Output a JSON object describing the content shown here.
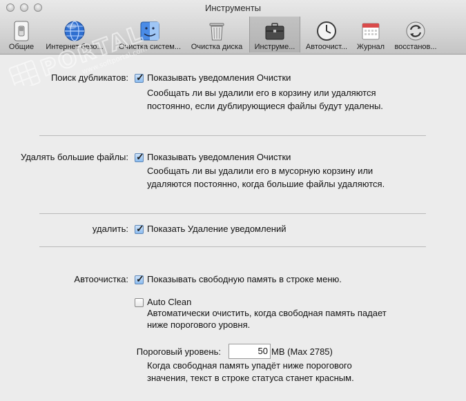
{
  "window": {
    "title": "Инструменты"
  },
  "toolbar": {
    "items": [
      {
        "label": "Общие",
        "icon": "switch-icon"
      },
      {
        "label": "Интернет безо...",
        "icon": "globe-icon"
      },
      {
        "label": "Очистка систем...",
        "icon": "finder-icon"
      },
      {
        "label": "Очистка диска",
        "icon": "trash-icon"
      },
      {
        "label": "Инструме...",
        "icon": "briefcase-icon",
        "selected": true
      },
      {
        "label": "Автоочист...",
        "icon": "clock-icon"
      },
      {
        "label": "Журнал",
        "icon": "calendar-icon"
      },
      {
        "label": "восстанов...",
        "icon": "restore-icon"
      }
    ]
  },
  "watermark": {
    "brand": "PORTAL",
    "site": "www.softportal.com",
    "tm": "TM"
  },
  "duplicates": {
    "label": "Поиск дубликатов:",
    "checkbox_label": "Показывать уведомления Очистки",
    "checked": true,
    "desc_line1": "Сообщать ли вы удалили его в корзину или удаляются",
    "desc_line2": "постоянно, если дублирующиеся файлы будут удалены."
  },
  "large_files": {
    "label": "Удалять большие файлы:",
    "checkbox_label": "Показывать уведомления Очистки",
    "checked": true,
    "desc_line1": "Сообщать ли вы удалили его в мусорную корзину или",
    "desc_line2": "удаляются постоянно, когда большие файлы удаляются."
  },
  "delete": {
    "label": "удалить:",
    "checkbox_label": "Показать Удаление уведомлений",
    "checked": true
  },
  "autoclean": {
    "label": "Автоочистка:",
    "show_memory_label": "Показывать свободную память в строке меню.",
    "show_memory_checked": true,
    "auto_clean_label": "Auto Clean",
    "auto_clean_checked": false,
    "auto_desc_line1": "Автоматически очистить, когда свободная память падает",
    "auto_desc_line2": "ниже порогового уровня.",
    "threshold_label": "Пороговый уровень:",
    "threshold_value": "50",
    "threshold_unit": "MB (Max 2785)",
    "threshold_desc_line1": "Когда свободная память упадёт ниже порогового",
    "threshold_desc_line2": "значения, текст в строке статуса станет красным."
  }
}
